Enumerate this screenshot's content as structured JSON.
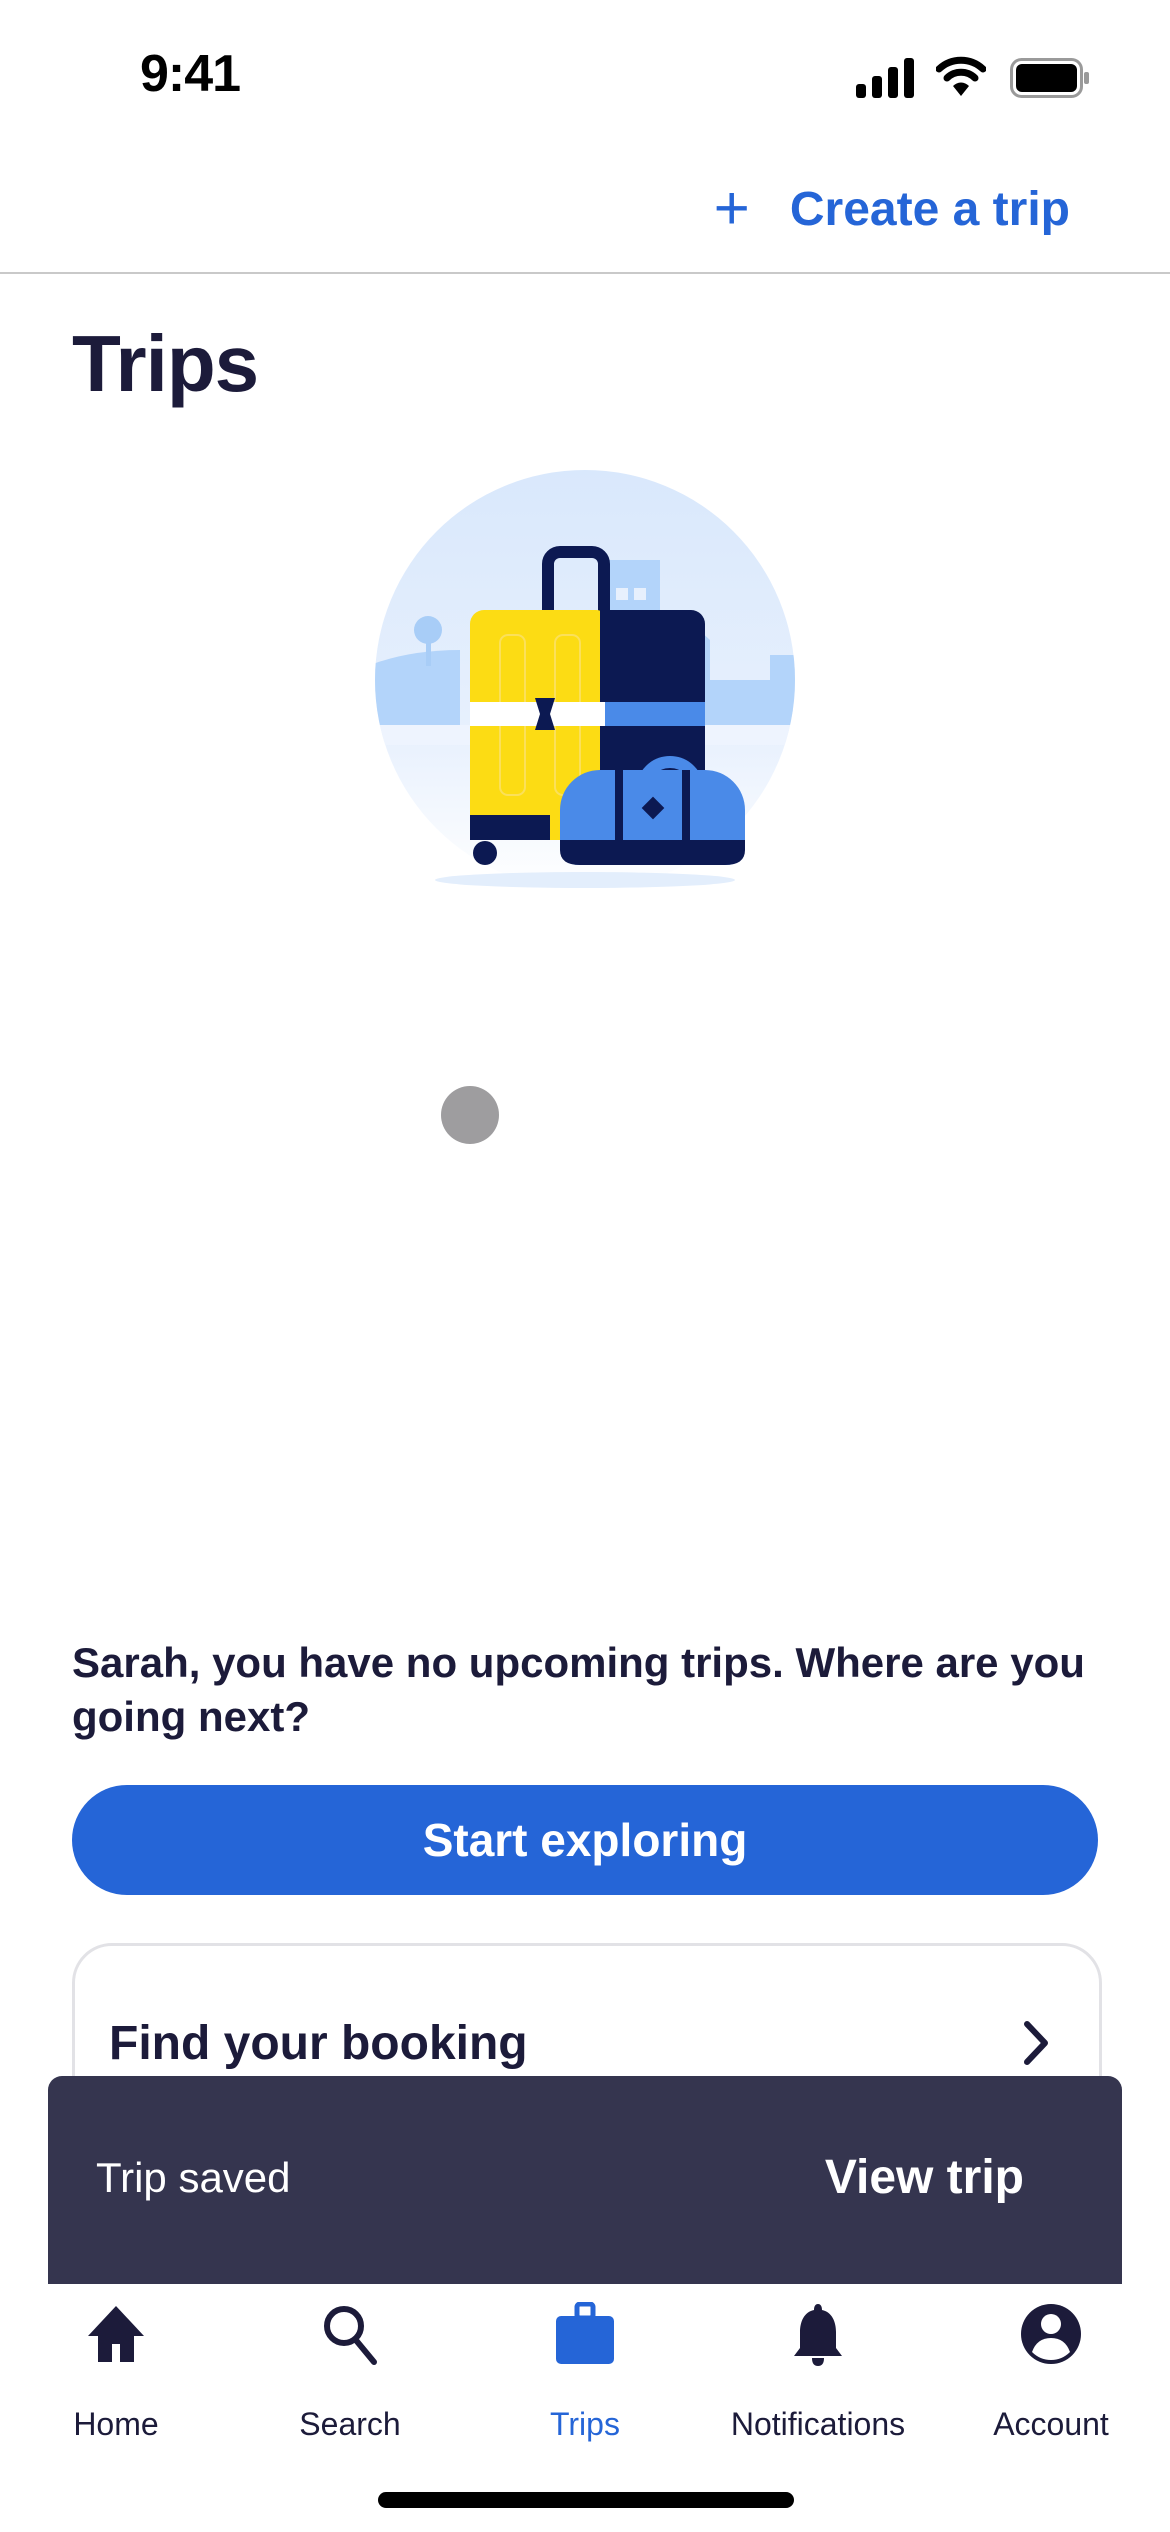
{
  "status_bar": {
    "time": "9:41"
  },
  "header": {
    "create_trip_icon": "plus-icon",
    "create_trip_label": "Create a trip"
  },
  "page": {
    "title": "Trips",
    "illustration": "luggage-illustration"
  },
  "empty_state": {
    "message": "Sarah, you have no upcoming trips. Where are you going next?",
    "primary_button": "Start exploring"
  },
  "booking_card": {
    "label": "Find your booking",
    "icon": "chevron-right-icon"
  },
  "toast": {
    "message": "Trip saved",
    "action": "View trip"
  },
  "tab_bar": {
    "active": "Trips",
    "items": [
      {
        "label": "Home",
        "icon": "home-icon"
      },
      {
        "label": "Search",
        "icon": "search-icon"
      },
      {
        "label": "Trips",
        "icon": "suitcase-icon"
      },
      {
        "label": "Notifications",
        "icon": "bell-icon"
      },
      {
        "label": "Account",
        "icon": "account-icon"
      }
    ]
  },
  "colors": {
    "accent": "#2565d7",
    "text": "#1c1b3a",
    "toast_bg": "#35354f"
  }
}
